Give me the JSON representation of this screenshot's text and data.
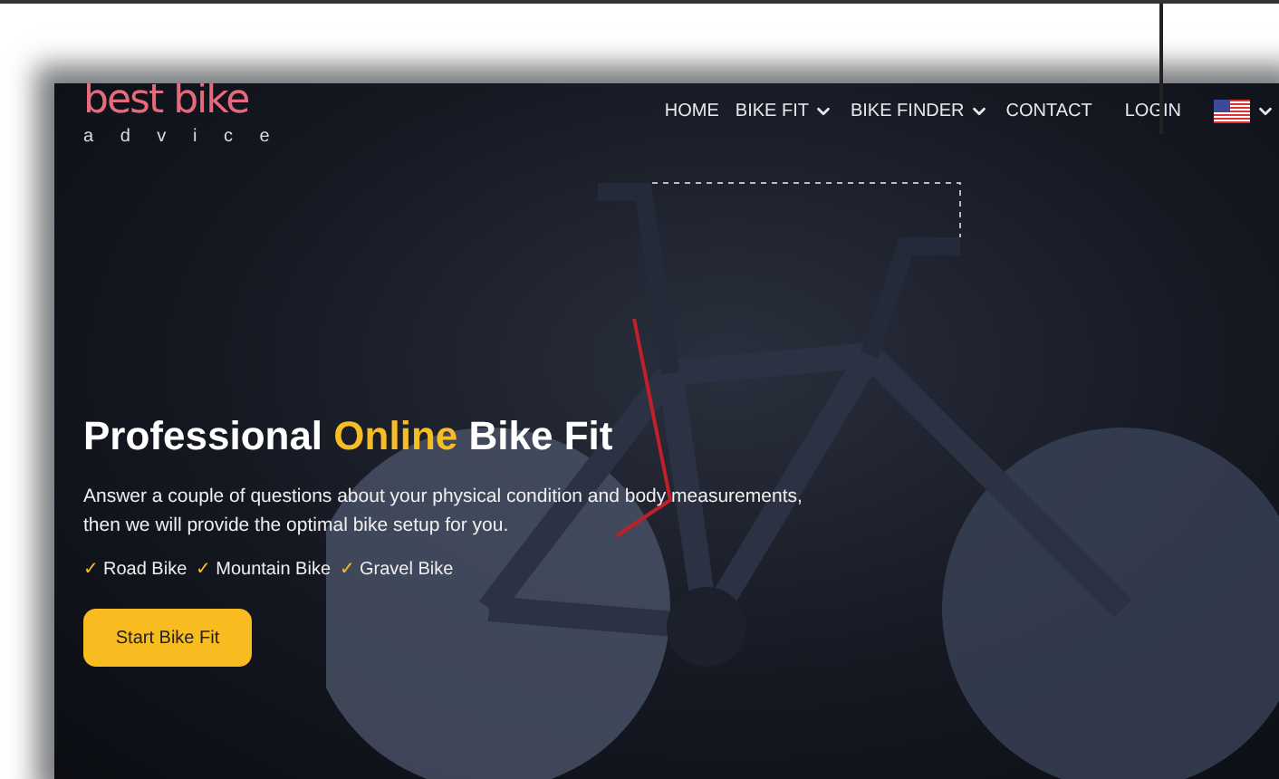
{
  "logo": {
    "title": "best bike",
    "subtitle": "a d v i c e"
  },
  "nav": [
    {
      "label": "HOME",
      "dropdown": false
    },
    {
      "label": "BIKE FIT",
      "dropdown": true
    },
    {
      "label": "BIKE FINDER",
      "dropdown": true
    },
    {
      "label": "CONTACT",
      "dropdown": false
    },
    {
      "label": "LOGIN",
      "dropdown": false
    }
  ],
  "hero": {
    "headline": {
      "before": "Professional",
      "highlight": "Online",
      "after": "Bike Fit"
    },
    "description": "Answer a couple of questions about your physical condition and body measurements, then we will provide the optimal bike setup for you.",
    "features": [
      {
        "mark": "✓",
        "label": "Road Bike"
      },
      {
        "mark": "✓",
        "label": "Mountain Bike"
      },
      {
        "mark": "✓",
        "label": "Gravel Bike"
      }
    ],
    "cta": "Start Bike Fit"
  }
}
